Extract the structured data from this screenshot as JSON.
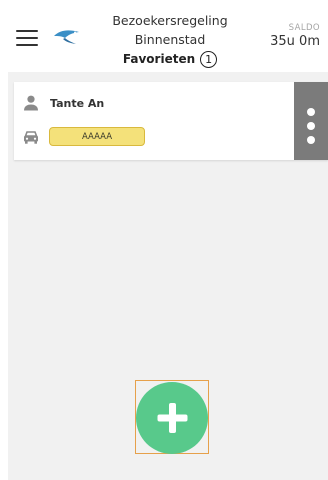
{
  "header": {
    "menu_icon": "hamburger-menu-icon",
    "logo_icon": "bird-logo-icon",
    "title_line1": "Bezoekersregeling",
    "title_line2": "Binnenstad",
    "favorites_label": "Favorieten",
    "favorites_count": "1",
    "saldo_label": "SALDO",
    "saldo_value": "35u 0m"
  },
  "favorites": [
    {
      "name": "Tante An",
      "person_icon": "person-icon",
      "car_icon": "car-icon",
      "license_plate": "AAAAA",
      "more_icon": "vertical-dots-icon"
    }
  ],
  "fab": {
    "icon": "plus-icon"
  },
  "colors": {
    "accent_green": "#58c98b",
    "plate_yellow": "#f4e17a",
    "more_gray": "#7b7b7b",
    "background_gray": "#f1f1f1"
  }
}
